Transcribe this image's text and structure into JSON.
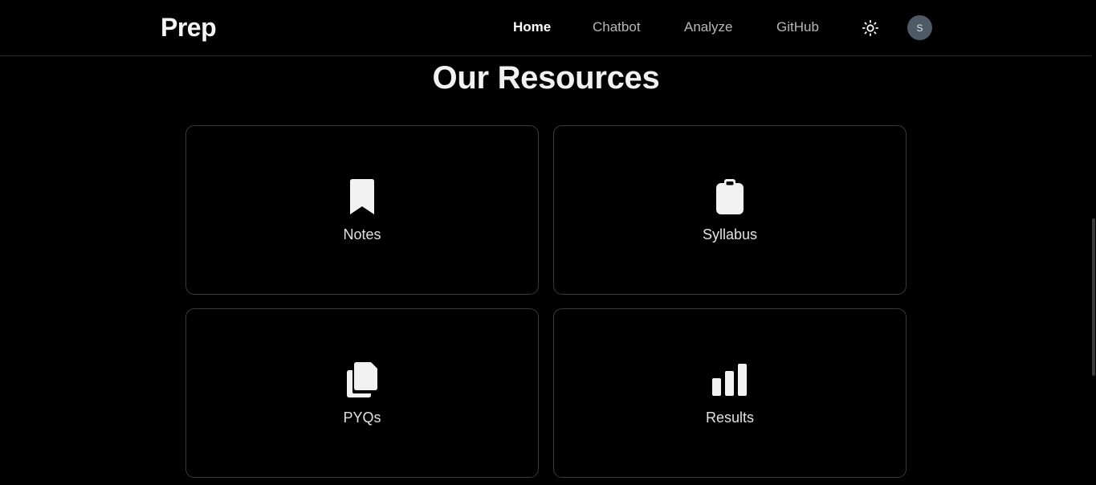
{
  "header": {
    "brand": "Prep",
    "nav": [
      {
        "label": "Home",
        "active": true
      },
      {
        "label": "Chatbot",
        "active": false
      },
      {
        "label": "Analyze",
        "active": false
      },
      {
        "label": "GitHub",
        "active": false
      }
    ],
    "theme_toggle_icon": "sun-icon",
    "avatar_initial": "S"
  },
  "main": {
    "title": "Our Resources",
    "cards": [
      {
        "label": "Notes",
        "icon": "bookmark-icon"
      },
      {
        "label": "Syllabus",
        "icon": "clipboard-icon"
      },
      {
        "label": "PYQs",
        "icon": "copy-documents-icon"
      },
      {
        "label": "Results",
        "icon": "bar-chart-icon"
      }
    ]
  },
  "colors": {
    "background": "#000000",
    "text": "#ffffff",
    "muted_text": "#b8b8b8",
    "border": "#3a3a3a",
    "avatar_bg": "#4e5a66"
  }
}
